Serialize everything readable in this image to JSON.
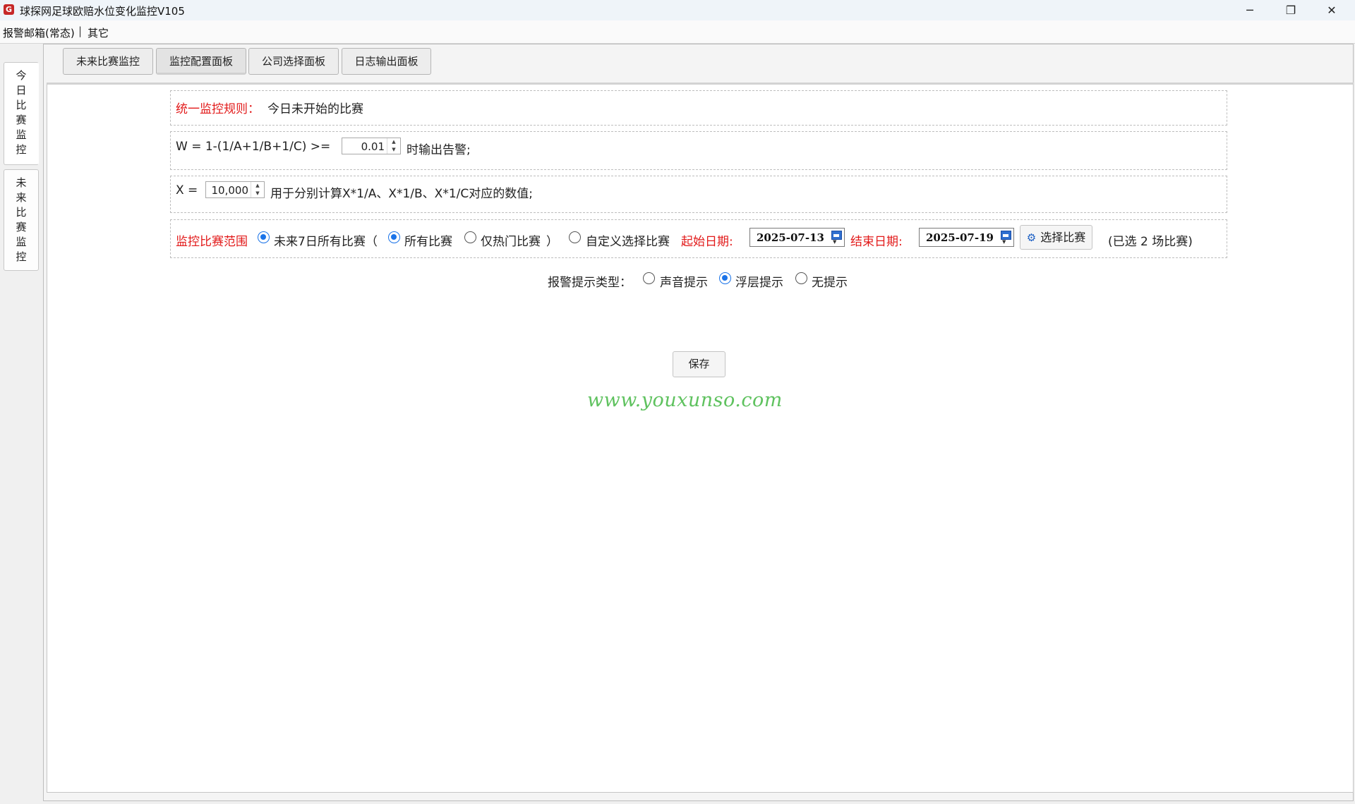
{
  "window": {
    "title": "球探网足球欧赔水位变化监控V105",
    "icon": "app-logo-icon",
    "controls": {
      "minimize": "─",
      "restore": "❐",
      "close": "✕"
    }
  },
  "menu": {
    "items": [
      "报警邮箱(常态)",
      "其它"
    ],
    "separator": "|"
  },
  "side_tabs": [
    {
      "label": "今日比赛监控",
      "chars": [
        "今",
        "日",
        "比",
        "赛",
        "监",
        "控"
      ]
    },
    {
      "label": "未来比赛监控",
      "chars": [
        "未",
        "来",
        "比",
        "赛",
        "监",
        "控"
      ]
    }
  ],
  "tabs": [
    "未来比赛监控",
    "监控配置面板",
    "公司选择面板",
    "日志输出面板"
  ],
  "active_tab": "监控配置面板",
  "rule": {
    "label": "统一监控规则：",
    "value": "今日未开始的比赛"
  },
  "formula_w": {
    "prefix": "W = 1-(1/A+1/B+1/C) >=",
    "value": "0.01",
    "suffix": "时输出告警;"
  },
  "formula_x": {
    "prefix": "X =",
    "value": "10,000",
    "suffix": "用于分别计算X*1/A、X*1/B、X*1/C对应的数值;"
  },
  "range": {
    "label": "监控比赛范围",
    "option_future7": "未来7日所有比赛（",
    "option_all": "所有比赛",
    "option_hot": "仅热门比赛",
    "close_paren": "）",
    "option_custom": "自定义选择比赛",
    "start_label": "起始日期:",
    "start_date": "2025-07-13",
    "end_label": "结束日期:",
    "end_date": "2025-07-19",
    "select_button": "选择比赛",
    "selected_info": "(已选 2 场比赛)"
  },
  "alert": {
    "label": "报警提示类型：",
    "options": [
      "声音提示",
      "浮层提示",
      "无提示"
    ],
    "selected": "浮层提示"
  },
  "save_button": "保存",
  "watermark": "www.youxunso.com",
  "colors": {
    "highlight_red": "#e21a1a",
    "radio_blue": "#1a73e8",
    "watermark_green": "#5fc25f"
  }
}
